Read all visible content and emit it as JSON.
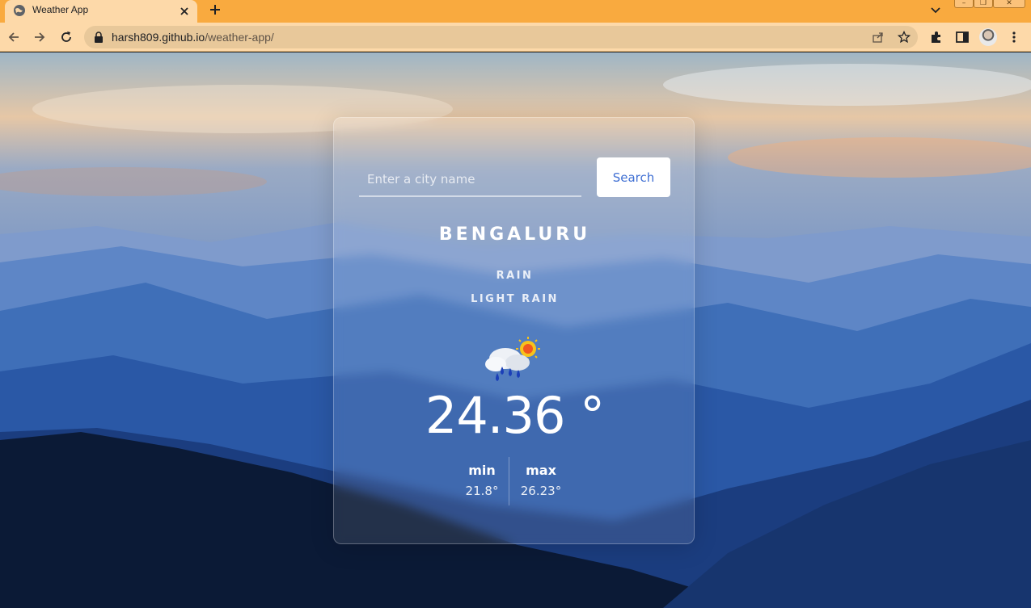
{
  "browser": {
    "tab_title": "Weather App",
    "url_host": "harsh809.github.io",
    "url_path": "/weather-app/"
  },
  "app": {
    "search": {
      "placeholder": "Enter a city name",
      "value": "",
      "button_label": "Search"
    },
    "city": "BENGALURU",
    "condition": "RAIN",
    "description": "LIGHT RAIN",
    "weather_icon": "rain-sun-cloud-icon",
    "temperature": "24.36 °",
    "min_label": "min",
    "min_value": "21.8°",
    "max_label": "max",
    "max_value": "26.23°"
  },
  "colors": {
    "tabbar": "#f9aa3f",
    "toolbar": "#fdd9a9",
    "search_button_text": "#3f6fd3"
  }
}
